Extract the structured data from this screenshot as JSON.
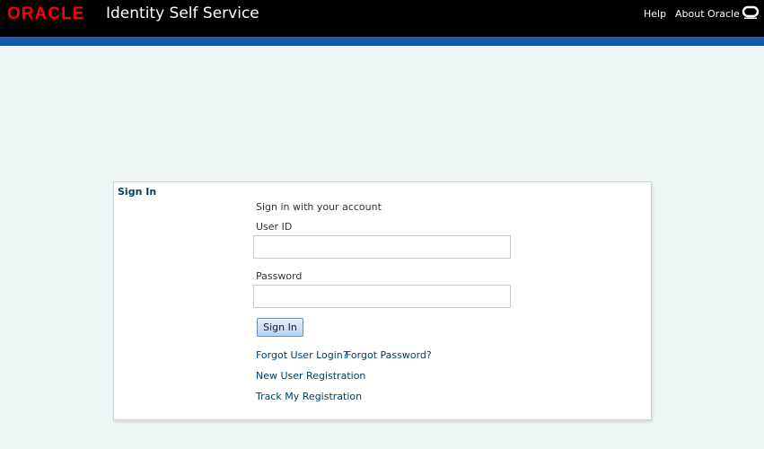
{
  "header": {
    "logo": "ORACLE",
    "title": "Identity Self Service",
    "nav": {
      "help": "Help",
      "about": "About Oracle"
    },
    "logo_icon": "oracle-o-icon"
  },
  "colors": {
    "header_bg": "#000000",
    "logo": "#ff0000",
    "band": "#1b62b3",
    "page_bg": "#eef6f5",
    "link": "#003f66"
  },
  "signin": {
    "title": "Sign In",
    "subtitle": "Sign in with your account",
    "user_label": "User ID",
    "user_value": "",
    "password_label": "Password",
    "password_value": "",
    "button": "Sign In",
    "links": {
      "forgot_login": "Forgot User Login?",
      "forgot_password": "Forgot Password?",
      "register": "New User Registration",
      "track": "Track My Registration"
    }
  }
}
